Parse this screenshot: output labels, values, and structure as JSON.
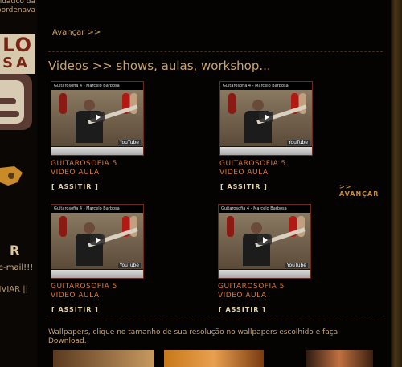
{
  "sidebar": {
    "top_text_line1": "didático da",
    "top_text_line2": "pordenava",
    "logo_line1": "LO",
    "logo_line2": "SA",
    "letter": "R",
    "email_text": "e-mail!!!",
    "enviar_text": "NVIAR ||"
  },
  "main": {
    "advance_top": "Avançar >>",
    "section_title": "Videos >> shows, aulas, workshop...",
    "video_bar_text": "Guitarosofia 4 - Marcelo Barbosa",
    "videos": [
      {
        "title_line1": "GUITAROSOFIA 5",
        "title_line2": "VIDEO AULA",
        "watch": "[ ASSITIR ]"
      },
      {
        "title_line1": "GUITAROSOFIA 5",
        "title_line2": "VIDEO AULA",
        "watch": "[ ASSITIR ]"
      },
      {
        "title_line1": "GUITAROSOFIA 5",
        "title_line2": "VIDEO AULA",
        "watch": "[ ASSITIR ]"
      },
      {
        "title_line1": "GUITAROSOFIA 5",
        "title_line2": "VIDEO AULA",
        "watch": "[ ASSITIR ]"
      }
    ],
    "advance_right": ">> AVANÇAR",
    "wallpapers_text": "Wallpapers, clique no tamanho de sua resolução no wallpapers escolhido e faça Download.",
    "youtube_label": "YouTube"
  },
  "colors": {
    "accent_orange": "#d9763a",
    "text_gold": "#c9a46a",
    "background": "#000000"
  }
}
